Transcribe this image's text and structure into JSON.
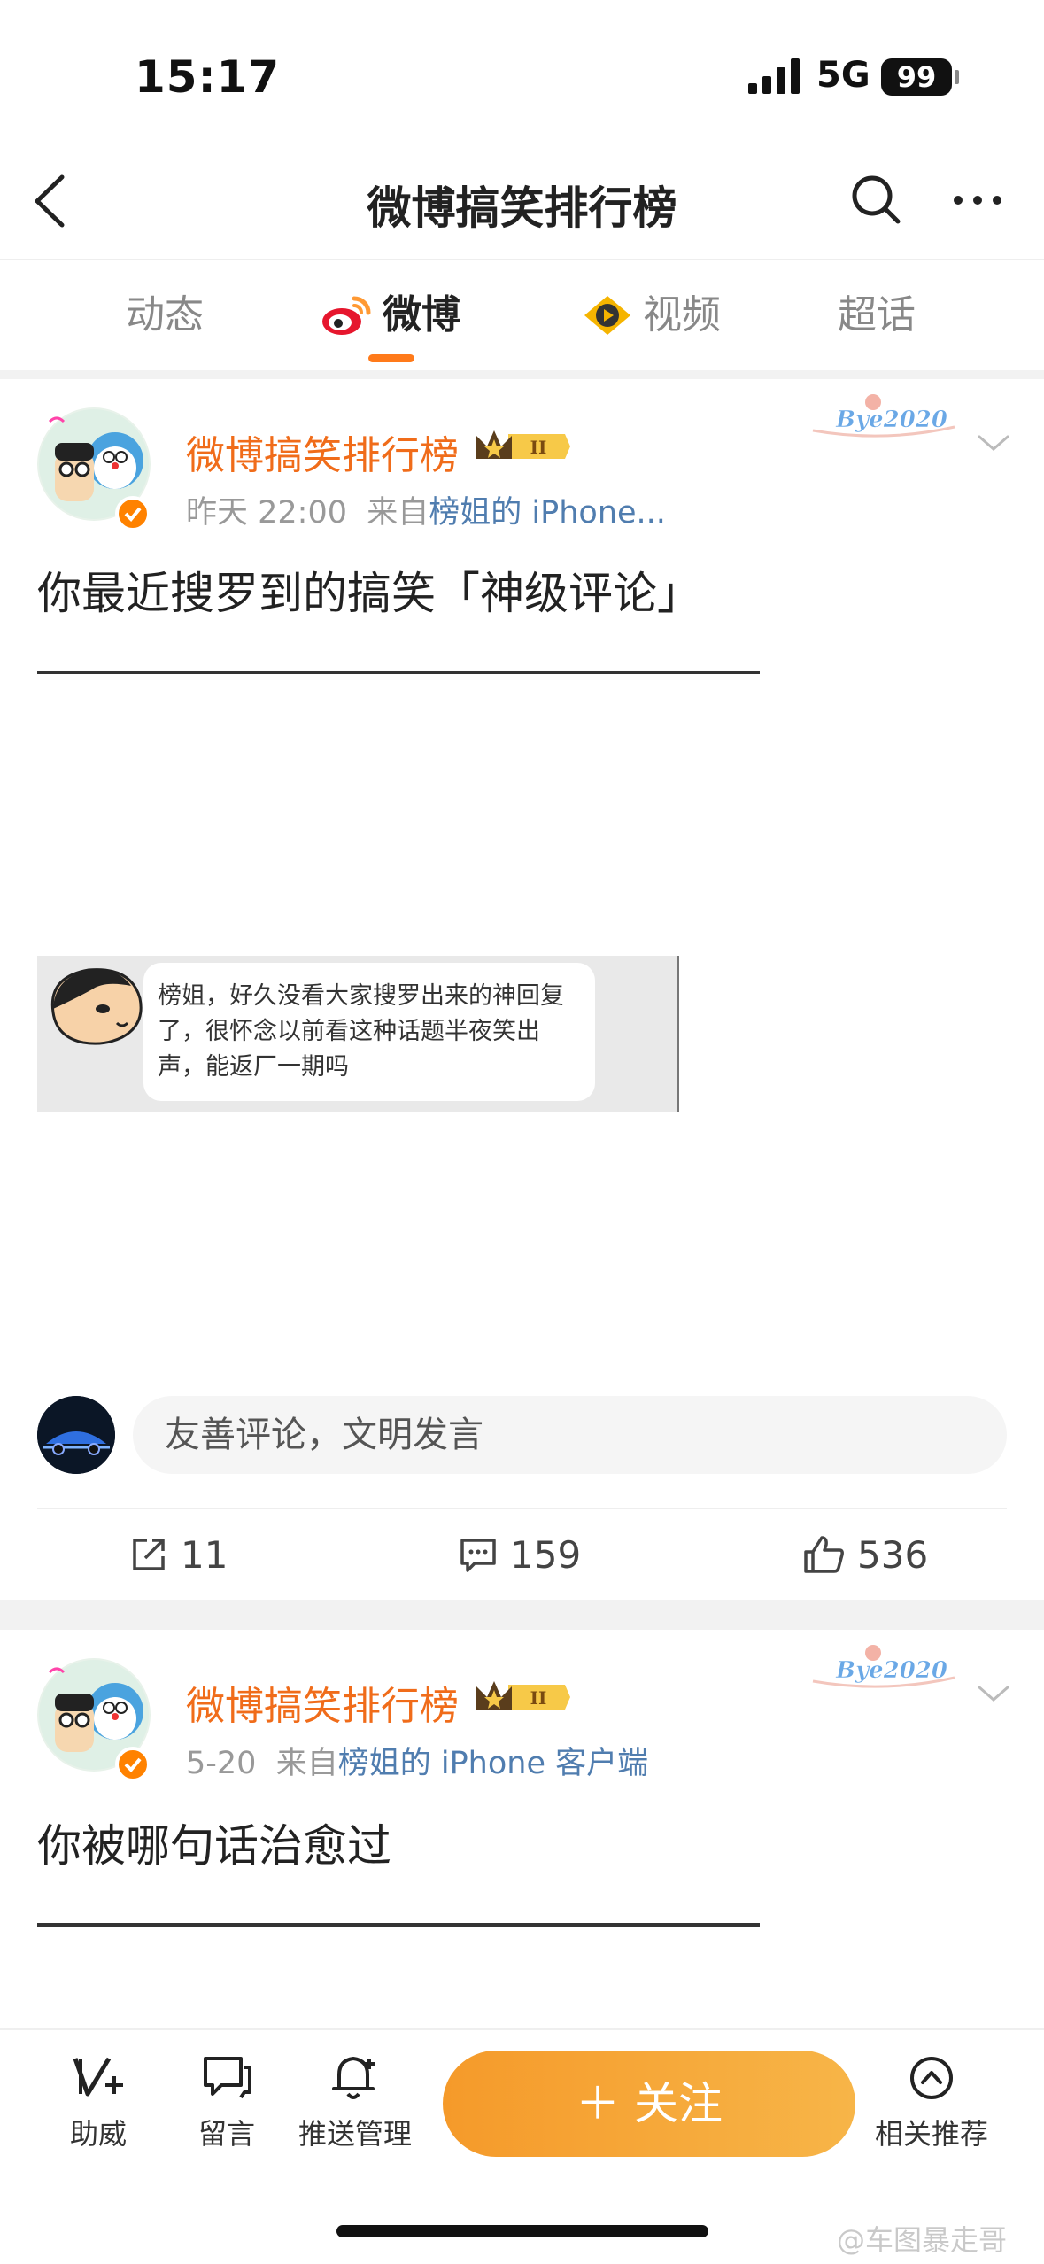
{
  "status_bar": {
    "time": "15:17",
    "network": "5G",
    "battery": "99"
  },
  "nav": {
    "title": "微博搞笑排行榜"
  },
  "tabs": [
    {
      "label": "动态"
    },
    {
      "label": "微博"
    },
    {
      "label": "视频"
    },
    {
      "label": "超话"
    }
  ],
  "posts": [
    {
      "author": "微博搞笑排行榜",
      "time": "昨天 22:00",
      "source_prefix": "来自",
      "source": "榜姐的 iPhone...",
      "text": "你最近搜罗到的搞笑「神级评论」",
      "embed_text": "榜姐，好久没看大家搜罗出来的神回复了，很怀念以前看这种话题半夜笑出声，能返厂一期吗",
      "comment_placeholder": "友善评论，文明发言",
      "reposts": "11",
      "comments": "159",
      "likes": "536",
      "badge": "Bye2020"
    },
    {
      "author": "微博搞笑排行榜",
      "time": "5-20",
      "source_prefix": "来自",
      "source": "榜姐的 iPhone 客户端",
      "text": "你被哪句话治愈过",
      "badge": "Bye2020"
    }
  ],
  "bottom_bar": {
    "boost": "助威",
    "message": "留言",
    "push": "推送管理",
    "follow": "＋ 关注",
    "related": "相关推荐"
  },
  "watermark": "@车图暴走哥",
  "colors": {
    "accent": "#ff8200",
    "author": "#f06c1a",
    "link": "#507daf"
  }
}
